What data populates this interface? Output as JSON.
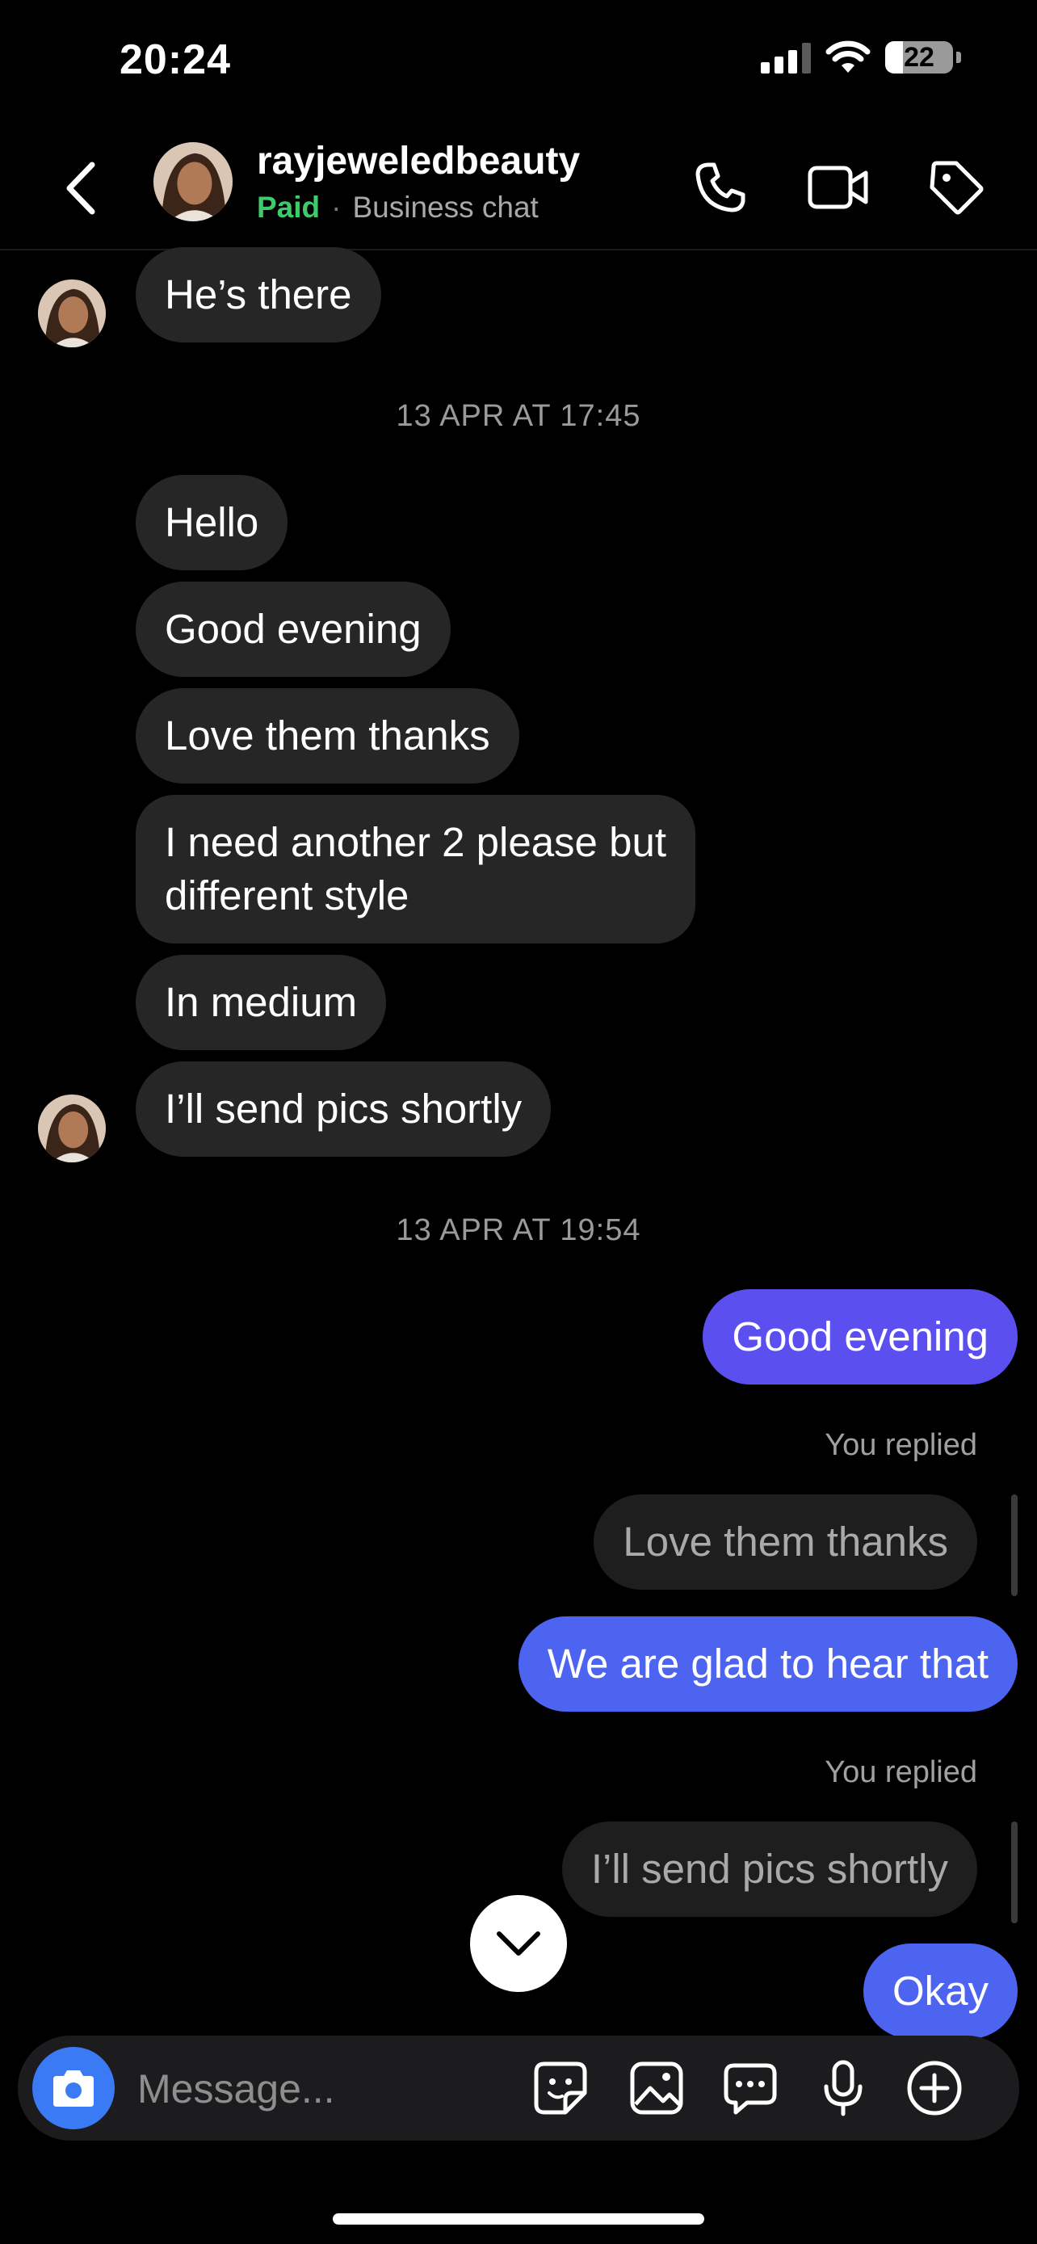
{
  "status_bar": {
    "time": "20:24",
    "battery_level": "22",
    "battery_fraction": 0.22
  },
  "header": {
    "contact_name": "rayjeweledbeauty",
    "paid_label": "Paid",
    "separator": "·",
    "subtitle": "Business chat",
    "icons": [
      "back-chevron-icon",
      "phone-icon",
      "video-camera-icon",
      "tag-icon"
    ]
  },
  "messages": {
    "m1": "He’s there",
    "ts1": "13 APR AT 17:45",
    "m2": "Hello",
    "m3": "Good evening",
    "m4": "Love them thanks",
    "m5_line1": "I need another 2 please but",
    "m5_line2": "different style",
    "m6": "In medium",
    "m7": "I’ll send pics shortly",
    "ts2": "13 APR AT 19:54",
    "s1": "Good evening",
    "replied_label_1": "You replied",
    "quote1": "Love them thanks",
    "s2": "We are glad to hear that",
    "replied_label_2": "You replied",
    "quote2": "I’ll send pics shortly",
    "s3": "Okay"
  },
  "composer": {
    "placeholder": "Message...",
    "icons": [
      "camera-icon",
      "sticker-icon",
      "gallery-icon",
      "chat-bubble-icon",
      "microphone-icon",
      "plus-icon"
    ]
  },
  "colors": {
    "background": "#000000",
    "received_bubble": "#262626",
    "sent_bubble": "#5b4ff0",
    "paid_green": "#3fcb6b",
    "camera_button": "#3a7bf5"
  }
}
